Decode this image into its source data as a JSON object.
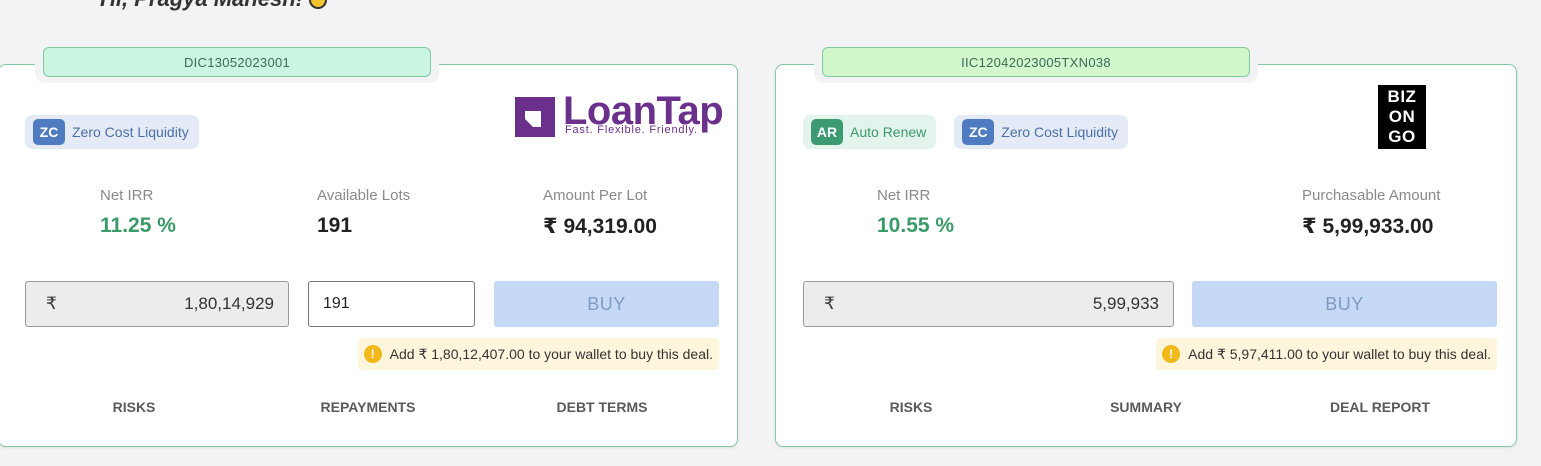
{
  "greeting": "Hi, Pragya Mahesh!",
  "colors": {
    "accent_green": "#3a9a68",
    "card_border": "#7fcaa0",
    "buy_disabled": "#c5d9f7"
  },
  "deals": [
    {
      "deal_id": "DIC13052023001",
      "badges": [
        {
          "abbr": "ZC",
          "label": "Zero Cost Liquidity"
        }
      ],
      "logo": {
        "name": "LoanTap",
        "tagline": "Fast. Flexible. Friendly."
      },
      "metrics": [
        {
          "label": "Net IRR",
          "value": "11.25 %"
        },
        {
          "label": "Available Lots",
          "value": "191"
        },
        {
          "label": "Amount Per Lot",
          "value": "₹ 94,319.00"
        }
      ],
      "currency_symbol": "₹",
      "amount_value": "1,80,14,929",
      "lots_value": "191",
      "buy_label": "BUY",
      "wallet_note": "Add ₹ 1,80,12,407.00 to your wallet to buy this deal.",
      "links": [
        "RISKS",
        "REPAYMENTS",
        "DEBT TERMS"
      ]
    },
    {
      "deal_id": "IIC12042023005TXN038",
      "badges": [
        {
          "abbr": "AR",
          "label": "Auto Renew"
        },
        {
          "abbr": "ZC",
          "label": "Zero Cost Liquidity"
        }
      ],
      "logo": {
        "lines": [
          "BIZ",
          "ON",
          "GO"
        ]
      },
      "metrics": [
        {
          "label": "Net IRR",
          "value": "10.55 %"
        },
        {
          "label": "Purchasable Amount",
          "value": "₹ 5,99,933.00"
        }
      ],
      "currency_symbol": "₹",
      "amount_value": "5,99,933",
      "buy_label": "BUY",
      "wallet_note": "Add ₹ 5,97,411.00 to your wallet to buy this deal.",
      "links": [
        "RISKS",
        "SUMMARY",
        "DEAL REPORT"
      ]
    }
  ]
}
